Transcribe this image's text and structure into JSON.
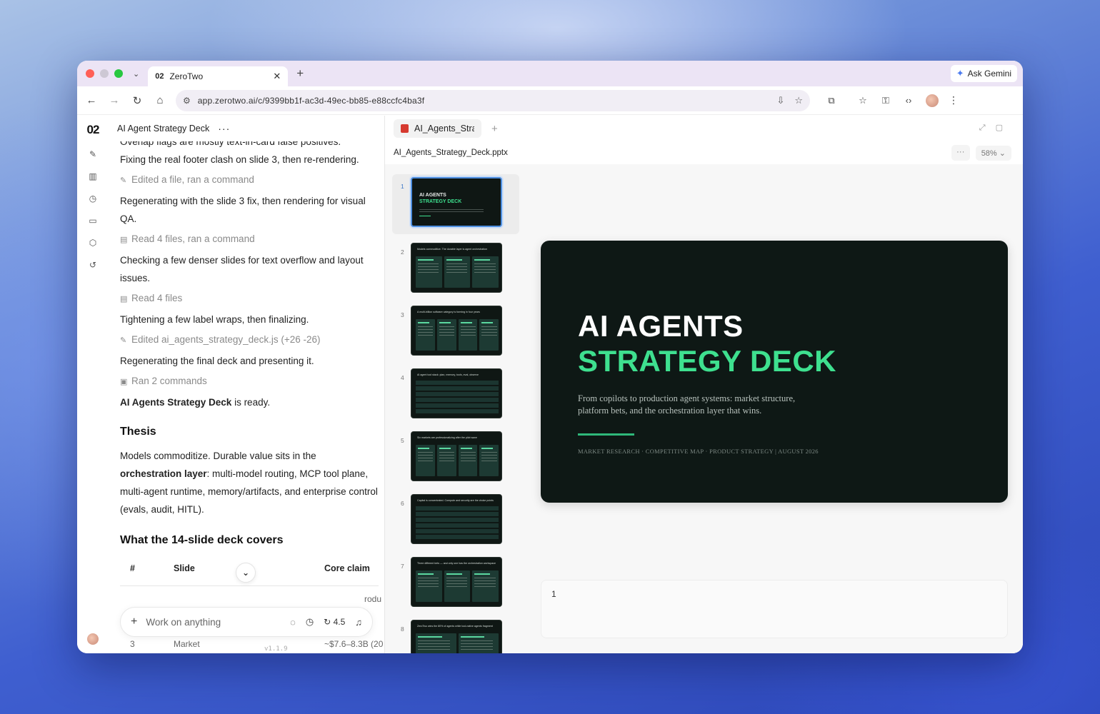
{
  "browser": {
    "tab_title": "ZeroTwo",
    "tab_favicon": "02",
    "gemini_label": "Ask Gemini",
    "url": "app.zerotwo.ai/c/9399bb1f-ac3d-49ec-bb85-e88ccfc4ba3f"
  },
  "app": {
    "logo": "02",
    "chat_title": "AI Agent Strategy Deck"
  },
  "chat": {
    "partial_top": "Overlap flags are mostly text-in-card false positives.",
    "msg1": "Fixing the real footer clash on slide 3, then re-rendering.",
    "step1": "Edited a file, ran a command",
    "msg2": "Regenerating with the slide 3 fix, then rendering for visual QA.",
    "step2": "Read 4 files, ran a command",
    "msg3": "Checking a few denser slides for text overflow and layout issues.",
    "step3": "Read 4 files",
    "msg4": "Tightening a few label wraps, then finalizing.",
    "step4": "Edited ai_agents_strategy_deck.js (+26 -26)",
    "msg5": "Regenerating the final deck and presenting it.",
    "step5": "Ran 2 commands",
    "ready_bold": "AI Agents Strategy Deck",
    "ready_rest": " is ready.",
    "thesis_heading": "Thesis",
    "thesis_a": "Models commoditize. Durable value sits in the ",
    "thesis_bold": "orchestration layer",
    "thesis_b": ": multi-model routing, MCP tool plane, multi-agent runtime, memory/artifacts, and enterprise control (evals, audit, HITL).",
    "covers_heading": "What the 14-slide deck covers",
    "table_headers": {
      "num": "#",
      "slide": "Slide",
      "claim": "Core claim"
    },
    "hidden_row_claim_frag": "rodu",
    "row3": {
      "num": "3",
      "slide": "Market",
      "claim": "~$7.6–8.3B (20"
    }
  },
  "composer": {
    "placeholder": "Work on anything",
    "model": "4.5",
    "version": "v1.1.9"
  },
  "viewer": {
    "tab_label": "AI_Agents_Strategy_Deck.pptx",
    "filename": "AI_Agents_Strategy_Deck.pptx",
    "more": "···",
    "zoom": "58%",
    "thumbs": [
      {
        "num": "1",
        "title": ""
      },
      {
        "num": "2",
        "title": "Models commoditize. The durable layer is agent orchestration"
      },
      {
        "num": "3",
        "title": "A multi-billion software category is forming in four years"
      },
      {
        "num": "4",
        "title": "AI agent tool stack: plan, memory, tools, eval, observe"
      },
      {
        "num": "5",
        "title": "Six markets are professionalizing after the pilot wave"
      },
      {
        "num": "6",
        "title": "Capital is concentrated. Compute and security are the choke points"
      },
      {
        "num": "7",
        "title": "Three different bets — and only one has the orchestration workspace"
      },
      {
        "num": "8",
        "title": "ZeroTwo wins the 80% of agents while tool-native agents fragment"
      }
    ],
    "slide": {
      "title_line1": "AI AGENTS",
      "title_line2": "STRATEGY DECK",
      "subtitle": "From copilots to production agent systems: market structure, platform bets, and the orchestration layer that wins.",
      "meta": "MARKET RESEARCH · COMPETITIVE MAP · PRODUCT STRATEGY | AUGUST 2026",
      "accent": "#3ee08f",
      "background": "#0e1815"
    },
    "notes_page": "1"
  }
}
